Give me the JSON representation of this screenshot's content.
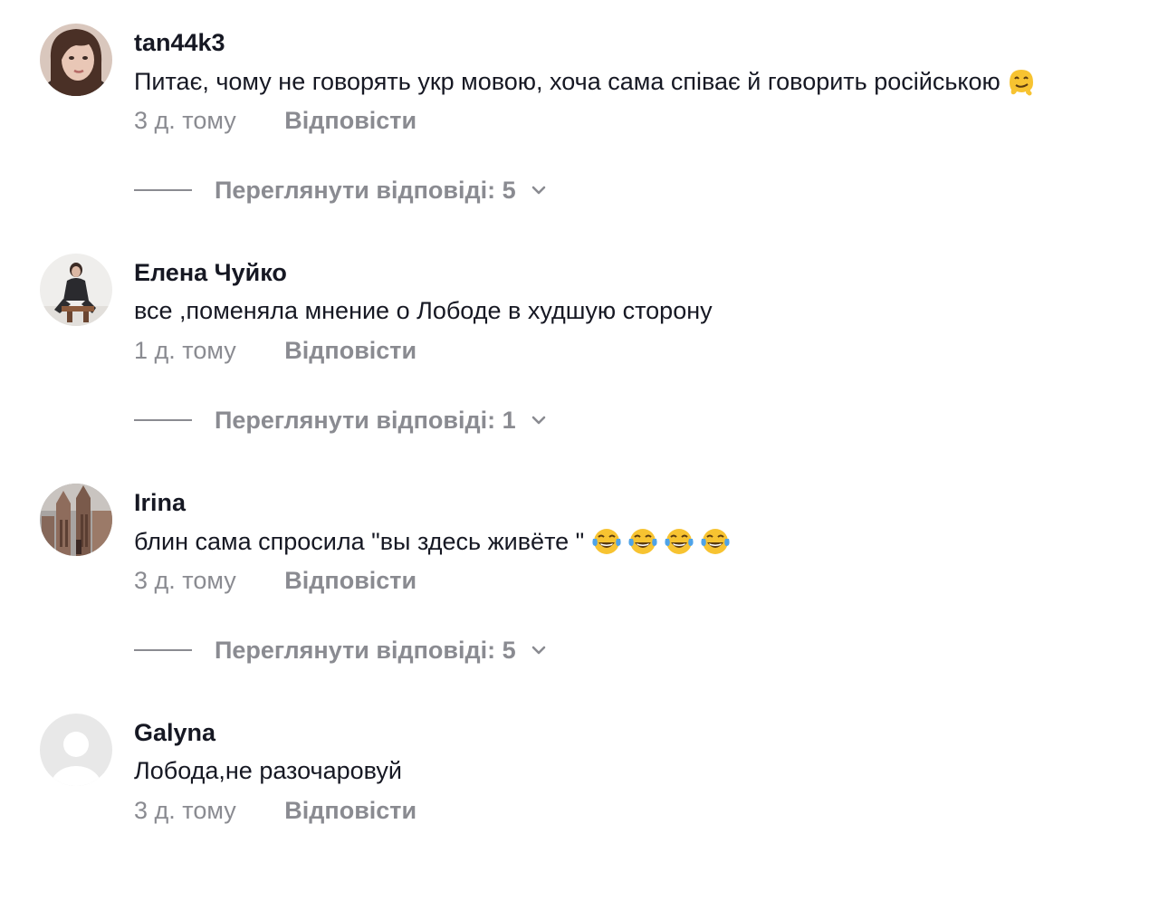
{
  "reply_label": "Відповісти",
  "colors": {
    "text_primary": "#161823",
    "text_secondary": "#8a8b91"
  },
  "comments": [
    {
      "username": "tan44k3",
      "text": "Питає, чому не говорять укр мовою, хоча сама співає й говорить російською",
      "emojis": [
        "melting-face-emoji"
      ],
      "time": "3 д. тому",
      "reply": "Відповісти",
      "view_replies": "Переглянути відповіді: 5",
      "avatar": "avatar-woman-portrait"
    },
    {
      "username": "Елена Чуйко",
      "text": "все ,поменяла мнение о Лободе в худшую сторону",
      "emojis": [],
      "time": "1 д. тому",
      "reply": "Відповісти",
      "view_replies": "Переглянути відповіді: 1",
      "avatar": "avatar-seated-woman"
    },
    {
      "username": "Irina",
      "text": "блин сама спросила \"вы здесь живёте \"",
      "emojis": [
        "tears-of-joy-emoji",
        "tears-of-joy-emoji",
        "tears-of-joy-emoji",
        "tears-of-joy-emoji"
      ],
      "time": "3 д. тому",
      "reply": "Відповісти",
      "view_replies": "Переглянути відповіді: 5",
      "avatar": "avatar-cathedral"
    },
    {
      "username": "Galyna",
      "text": "Лобода,не разочаровуй",
      "emojis": [],
      "time": "3 д. тому",
      "reply": "Відповісти",
      "avatar": "avatar-default"
    }
  ]
}
